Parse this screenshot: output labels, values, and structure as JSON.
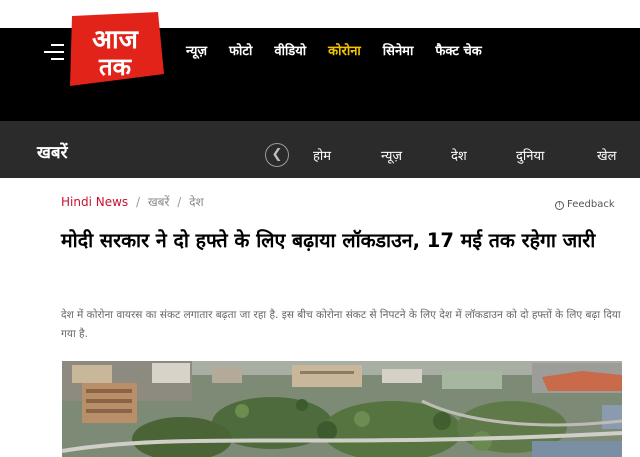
{
  "header": {
    "logo": {
      "line1": "आज",
      "line2": "तक",
      "color": "#e2231a"
    },
    "menu_icon": "hamburger-menu-icon",
    "nav": [
      {
        "label": "न्यूज़",
        "active": false
      },
      {
        "label": "फोटो",
        "active": false
      },
      {
        "label": "वीडियो",
        "active": false
      },
      {
        "label": "कोरोना",
        "active": true
      },
      {
        "label": "सिनेमा",
        "active": false
      },
      {
        "label": "फैक्ट चेक",
        "active": false
      }
    ],
    "active_color": "#f5c400"
  },
  "section": {
    "title": "खबरें",
    "prev_icon": "chevron-left-icon",
    "tabs": [
      {
        "label": "होम"
      },
      {
        "label": "न्यूज़"
      },
      {
        "label": "देश"
      },
      {
        "label": "दुनिया"
      },
      {
        "label": "खेल"
      }
    ]
  },
  "article": {
    "breadcrumb": {
      "home": "Hindi News",
      "separator": "/",
      "items": [
        "खबरें",
        "देश"
      ]
    },
    "feedback": {
      "label": "Feedback",
      "icon": "feedback-icon"
    },
    "headline": "मोदी सरकार ने दो हफ्ते के लिए बढ़ाया लॉकडाउन, 17 मई तक रहेगा जारी",
    "summary": "देश में कोरोना वायरस का संकट लगातार बढ़ता जा रहा है. इस बीच कोरोना संकट से निपटने के लिए देश में लॉकडाउन को दो हफ्तों के लिए बढ़ा दिया गया है.",
    "hero_image": "aerial-city-photo"
  }
}
